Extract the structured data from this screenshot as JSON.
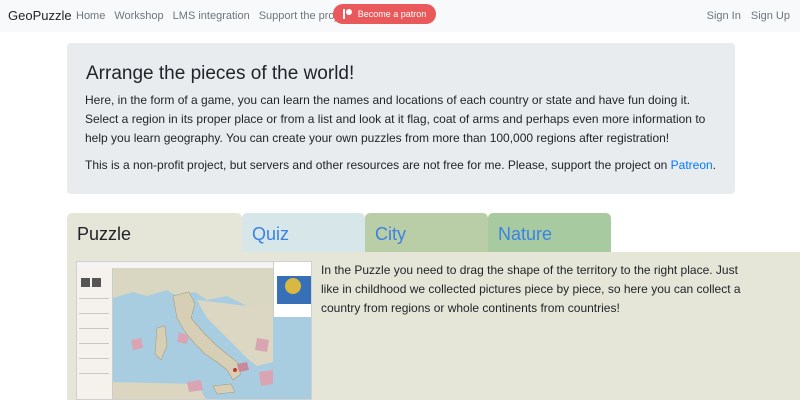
{
  "navbar": {
    "brand": "GeoPuzzle",
    "links": [
      "Home",
      "Workshop",
      "LMS integration",
      "Support the project"
    ],
    "patron_button": "Become a patron",
    "auth": [
      "Sign In",
      "Sign Up"
    ]
  },
  "jumbotron": {
    "title": "Arrange the pieces of the world!",
    "paragraph1": "Here, in the form of a game, you can learn the names and locations of each country or state and have fun doing it. Select a region in its proper place or from a list and look at it flag, coat of arms and perhaps even more information to help you learn geography. You can create your own puzzles from more than 100,000 regions after registration!",
    "paragraph2_prefix": "This is a non-profit project, but servers and other resources are not free for me. Please, support the project on ",
    "paragraph2_link": "Patreon",
    "paragraph2_suffix": "."
  },
  "tabs": [
    {
      "label": "Puzzle"
    },
    {
      "label": "Quiz"
    },
    {
      "label": "City"
    },
    {
      "label": "Nature"
    }
  ],
  "puzzle_tab": {
    "description": "In the Puzzle you need to drag the shape of the territory to the right place. Just like in childhood we collected pictures piece by piece, so here you can collect a country from regions or whole continents from countries!"
  },
  "colors": {
    "patron": "#e9585a",
    "link": "#007bff",
    "tab_puzzle": "#e5e6d8",
    "tab_quiz": "#d7e6e8",
    "tab_city": "#b9cda7",
    "tab_nature": "#a7caa0"
  }
}
